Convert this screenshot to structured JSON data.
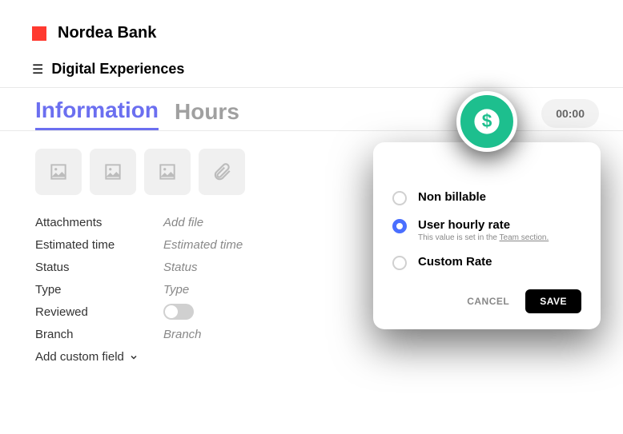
{
  "brand": {
    "title": "Nordea Bank"
  },
  "subheader": {
    "title": "Digital Experiences"
  },
  "tabs": {
    "information": "Information",
    "hours": "Hours"
  },
  "timer": {
    "value": "00:00"
  },
  "fields": {
    "attachments": {
      "label": "Attachments",
      "value": "Add file"
    },
    "estimated_time": {
      "label": "Estimated time",
      "value": "Estimated time"
    },
    "status": {
      "label": "Status",
      "value": "Status"
    },
    "type": {
      "label": "Type",
      "value": "Type"
    },
    "reviewed": {
      "label": "Reviewed"
    },
    "branch": {
      "label": "Branch",
      "value": "Branch"
    },
    "add_custom": "Add custom field"
  },
  "popover": {
    "options": {
      "non_billable": "Non billable",
      "user_hourly": "User hourly rate",
      "user_hourly_hint_prefix": "This value is set in the ",
      "user_hourly_hint_link": "Team section.",
      "custom_rate": "Custom Rate"
    },
    "cancel": "CANCEL",
    "save": "SAVE"
  }
}
